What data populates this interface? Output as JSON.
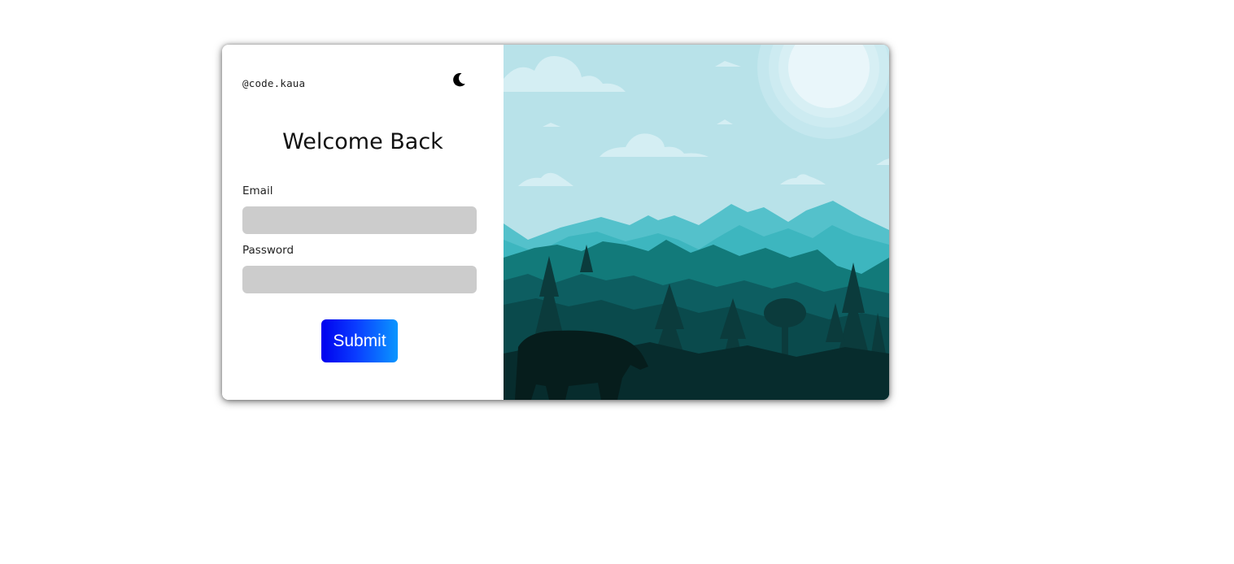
{
  "brand": {
    "handle": "@code.kaua"
  },
  "theme_toggle": {
    "icon": "moon-icon"
  },
  "form": {
    "title": "Welcome Back",
    "email_label": "Email",
    "email_value": "",
    "password_label": "Password",
    "password_value": "",
    "submit_label": "Submit"
  },
  "colors": {
    "field_bg": "#cccccc",
    "button_gradient_start": "#0000ee",
    "button_gradient_end": "#0a96ff",
    "sky": "#b8e2e9"
  }
}
